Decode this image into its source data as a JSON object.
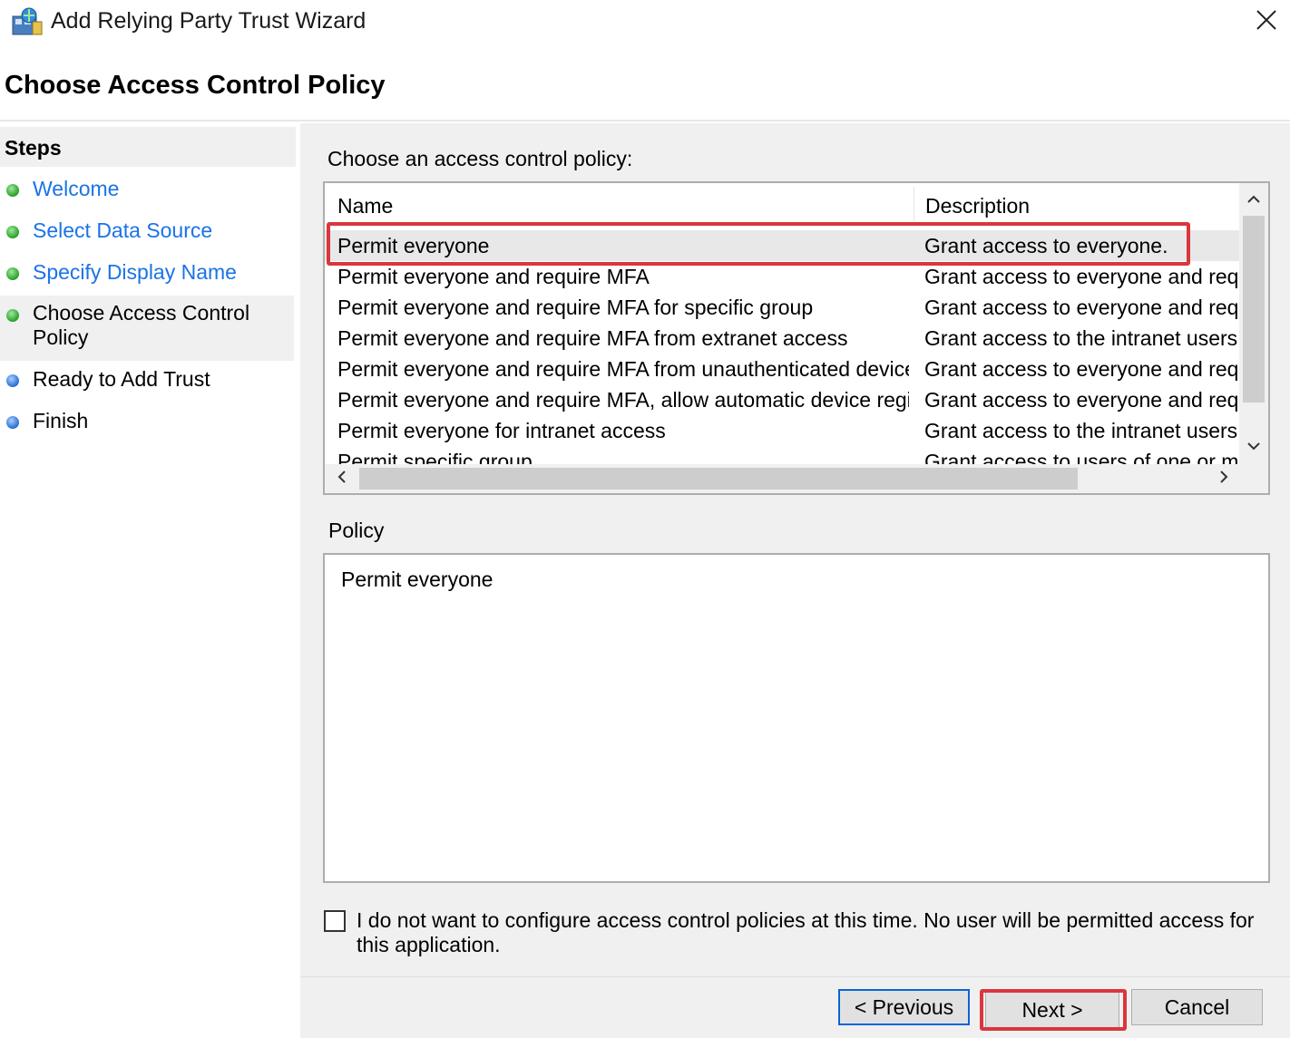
{
  "window": {
    "title": "Add Relying Party Trust Wizard",
    "icon": "relying-party-wizard-icon"
  },
  "header": {
    "page_title": "Choose Access Control Policy"
  },
  "steps": {
    "heading": "Steps",
    "items": [
      {
        "label": "Welcome",
        "state": "done"
      },
      {
        "label": "Select Data Source",
        "state": "done"
      },
      {
        "label": "Specify Display Name",
        "state": "done"
      },
      {
        "label": "Choose Access Control Policy",
        "state": "current"
      },
      {
        "label": "Ready to Add Trust",
        "state": "pending"
      },
      {
        "label": "Finish",
        "state": "pending"
      }
    ]
  },
  "policy_list": {
    "label": "Choose an access control policy:",
    "columns": [
      "Name",
      "Description"
    ],
    "rows": [
      {
        "name": "Permit everyone",
        "description": "Grant access to everyone.",
        "selected": true
      },
      {
        "name": "Permit everyone and require MFA",
        "description": "Grant access to everyone and requir"
      },
      {
        "name": "Permit everyone and require MFA for specific group",
        "description": "Grant access to everyone and requir"
      },
      {
        "name": "Permit everyone and require MFA from extranet access",
        "description": "Grant access to the intranet users ar"
      },
      {
        "name": "Permit everyone and require MFA from unauthenticated devices",
        "description": "Grant access to everyone and requir"
      },
      {
        "name": "Permit everyone and require MFA, allow automatic device registr...",
        "description": "Grant access to everyone and requir"
      },
      {
        "name": "Permit everyone for intranet access",
        "description": "Grant access to the intranet users."
      },
      {
        "name": "Permit specific group",
        "description": "Grant access to users of one or more"
      }
    ]
  },
  "policy": {
    "label": "Policy",
    "text": "Permit everyone"
  },
  "checkbox": {
    "label": "I do not want to configure access control policies at this time. No user will be permitted access for this application.",
    "checked": false
  },
  "buttons": {
    "previous": "< Previous",
    "next": "Next >",
    "cancel": "Cancel"
  },
  "colors": {
    "highlight": "#d9363e",
    "link": "#1a73e8",
    "focus_border": "#0a64d8"
  }
}
